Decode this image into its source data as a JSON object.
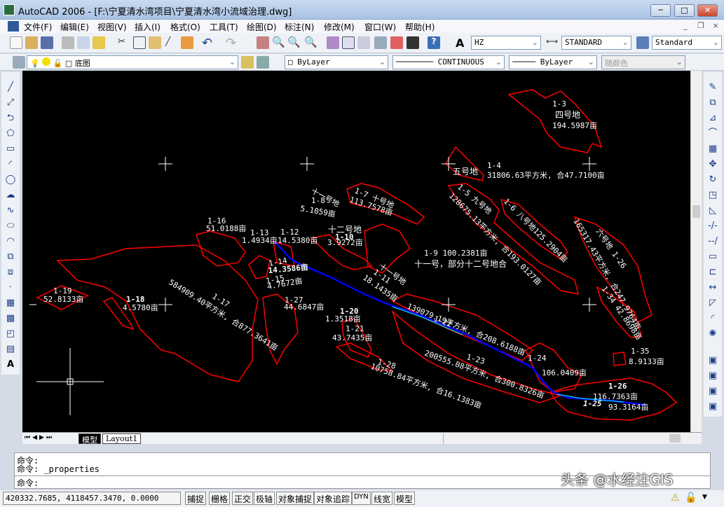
{
  "window": {
    "title": "AutoCAD 2006 - [F:\\宁夏清水湾项目\\宁夏清水湾小流域治理.dwg]",
    "minimize": "─",
    "maximize": "□",
    "close": "✕"
  },
  "menu": [
    "文件(F)",
    "编辑(E)",
    "视图(V)",
    "插入(I)",
    "格式(O)",
    "工具(T)",
    "绘图(D)",
    "标注(N)",
    "修改(M)",
    "窗口(W)",
    "帮助(H)"
  ],
  "mdi": {
    "minimize": "_",
    "restore": "❐",
    "close": "×"
  },
  "toolbar": {
    "text_style": "HZ",
    "dim_style": "STANDARD",
    "table_style": "Standard"
  },
  "layers": {
    "current_layer": "底图",
    "color": "ByLayer",
    "linetype": "CONTINUOUS",
    "lineweight": "ByLayer",
    "plot_style": "随颜色"
  },
  "colors": {
    "background": "#000000",
    "parcel": "#ff0000",
    "river": "#0000ff",
    "river_highlight": "#00ffff",
    "text": "#ffffff"
  },
  "labels": {
    "p1_3": "1-3",
    "n4": "四号地",
    "a1_3": "194.5987亩",
    "p1_4": "1-4",
    "n5": "五号地",
    "a1_4": "31806.63平方米, 合47.7100亩",
    "p1_7": "1-7  十号地",
    "a1_7": "113.7578亩",
    "n11": "十一号地",
    "p1_8": "1-8",
    "a1_8": "5.1059亩",
    "p1_5": "1-5  九号地",
    "a1_5": "128675.13平方米, 合193.0127亩",
    "p1_6": "1-6  八号地125.2904亩",
    "a1_26b": "165317.43平方米, 合247.9764亩",
    "n6": "六号地  1-26",
    "p1_34": "1-34  42.8698亩",
    "n12": "十二号地",
    "p1_10": "1-10",
    "a1_10": "3.9272亩",
    "p1_9": "1-9  100.2381亩",
    "n11b": "十一号，部分十二号地合",
    "n11c": "十一号地",
    "p1_11": "1-11",
    "a1_11": "18.1435亩",
    "p1_16": "1-16",
    "a1_16": "51.0188亩",
    "p1_13": "1-13",
    "a1_13": "1.4934亩",
    "p1_12": "1-12",
    "a1_12": "14.5380亩",
    "p1_14": "1-14",
    "a1_14": "14.3586亩",
    "p1_15": "1-15",
    "a1_15": "4.7672亩",
    "p1_19": "1-19",
    "a1_19": "52.8133亩",
    "p1_18": "1-18",
    "a1_18": "4.5780亩",
    "p1_17": "1-17",
    "a1_17": "584909.40平方米, 合877.3641亩",
    "p1_27": "1-27",
    "a1_27": "44.6847亩",
    "p1_20": "1-20",
    "a1_20": "1.3518亩",
    "p1_21": "1-21",
    "a1_21": "43.7435亩",
    "p1_28": "1-28",
    "a1_28": "10758.84平方米, 合16.1383亩",
    "p1_22": "1-22",
    "a1_22": "139079.19平方米, 合208.6188亩",
    "p1_23": "1-23",
    "a1_23": "200555.08平方米, 合300.8326亩",
    "p1_24": "1-24",
    "a1_24": "106.0409亩",
    "p1_35": "1-35",
    "a1_35": "8.9133亩",
    "p1_26": "1-26",
    "a1_26": "116.7363亩",
    "p1_25": "1-25",
    "a1_25": "93.3164亩"
  },
  "tabs": {
    "model": "模型",
    "layout1": "Layout1"
  },
  "command": {
    "line1": "命令:",
    "line2": "命令: _properties",
    "prompt": "命令:"
  },
  "status": {
    "coords": "420332.7685, 4118457.3470, 0.0000",
    "buttons": [
      "捕捉",
      "栅格",
      "正交",
      "极轴",
      "对象捕捉",
      "对象追踪",
      "DYN",
      "线宽",
      "模型"
    ]
  },
  "watermark": "头条 @水经注GIS"
}
